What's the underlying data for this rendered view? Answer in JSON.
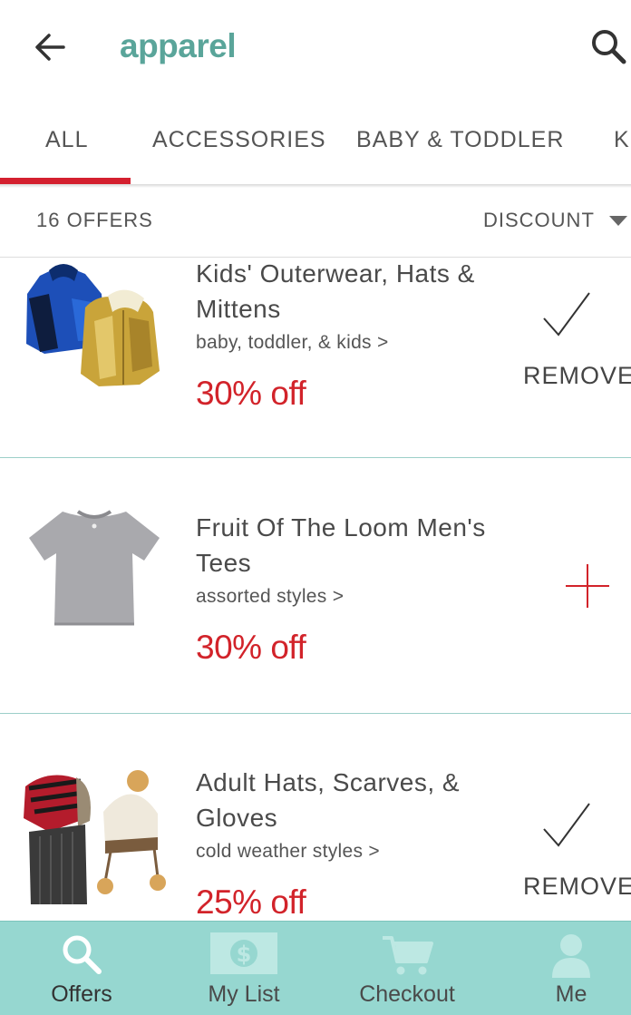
{
  "header": {
    "title": "apparel",
    "back_icon": "arrow-left-icon",
    "search_icon": "search-icon"
  },
  "tabs": [
    {
      "label": "ALL",
      "active": true
    },
    {
      "label": "ACCESSORIES",
      "active": false
    },
    {
      "label": "BABY & TODDLER",
      "active": false
    },
    {
      "label": "K",
      "active": false
    }
  ],
  "filter": {
    "count": "16 OFFERS",
    "sort": "DISCOUNT"
  },
  "offers": [
    {
      "name": "Kids' Outerwear, Hats & Mittens",
      "subtitle": "baby, toddler, & kids >",
      "discount": "30% off",
      "state": "added",
      "action_label": "REMOVE"
    },
    {
      "name": "Fruit Of The Loom Men's Tees",
      "subtitle": "assorted styles >",
      "discount": "30% off",
      "state": "not-added",
      "action_label": ""
    },
    {
      "name": "Adult Hats, Scarves, & Gloves",
      "subtitle": "cold weather styles >",
      "discount": "25% off",
      "state": "added",
      "action_label": "REMOVE"
    }
  ],
  "nav": [
    {
      "label": "Offers",
      "icon": "search-icon",
      "active": true
    },
    {
      "label": "My List",
      "icon": "dollar-bill-icon",
      "active": false
    },
    {
      "label": "Checkout",
      "icon": "cart-icon",
      "active": false
    },
    {
      "label": "Me",
      "icon": "person-icon",
      "active": false
    }
  ],
  "colors": {
    "brand_teal": "#5aa59a",
    "accent_red": "#d2232a",
    "nav_bg": "#96d7d0"
  }
}
